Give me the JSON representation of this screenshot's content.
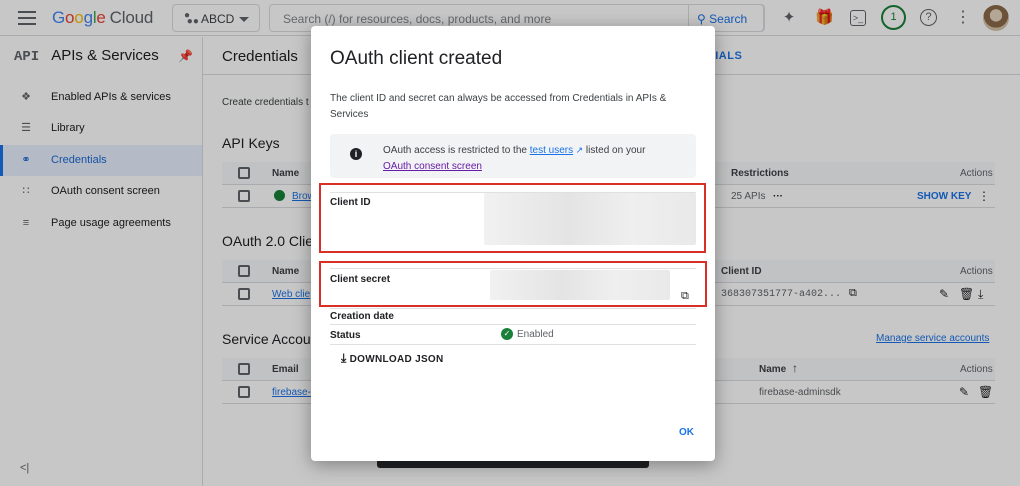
{
  "topbar": {
    "logo": {
      "g": "G",
      "o1": "o",
      "o2": "o",
      "g2": "g",
      "l": "l",
      "e": "e",
      "cloud": "Cloud"
    },
    "project": "ABCD",
    "search_placeholder": "Search (/) for resources, docs, products, and more",
    "search_button": "Search",
    "notifications_count": "1"
  },
  "sidebar": {
    "api_logo": "API",
    "title": "APIs & Services",
    "items": [
      {
        "label": "Enabled APIs & services",
        "icon": "diamond-icon"
      },
      {
        "label": "Library",
        "icon": "library-icon"
      },
      {
        "label": "Credentials",
        "icon": "key-icon"
      },
      {
        "label": "OAuth consent screen",
        "icon": "consent-icon"
      },
      {
        "label": "Page usage agreements",
        "icon": "agreements-icon"
      }
    ],
    "active": "Credentials"
  },
  "main": {
    "title": "Credentials",
    "tab_partial": "TIALS",
    "intro": "Create credentials t",
    "api_keys": {
      "title": "API Keys",
      "header": {
        "name": "Name",
        "restrictions": "Restrictions",
        "actions": "Actions"
      },
      "rows": [
        {
          "name": "Brow",
          "restrictions": "25 APIs",
          "more": "···",
          "show_key": "SHOW KEY"
        }
      ]
    },
    "oauth": {
      "title": "OAuth 2.0 Clie",
      "header": {
        "name": "Name",
        "client_id": "Client ID",
        "actions": "Actions"
      },
      "rows": [
        {
          "name": "Web clie",
          "client_id": "368307351777-a402..."
        }
      ]
    },
    "service": {
      "title": "Service Accou",
      "manage_link": "Manage service accounts",
      "header": {
        "email": "Email",
        "name": "Name",
        "actions": "Actions"
      },
      "rows": [
        {
          "email": "firebase-",
          "name": "firebase-adminsdk"
        }
      ]
    }
  },
  "dialog": {
    "title": "OAuth client created",
    "description": "The client ID and secret can always be accessed from Credentials in APIs & Services",
    "notice": {
      "prefix": "OAuth access is restricted to the ",
      "link1": "test users",
      "middle": " listed on your ",
      "link2": "OAuth consent screen"
    },
    "client_id_label": "Client ID",
    "client_secret_label": "Client secret",
    "creation_date_label": "Creation date",
    "status_label": "Status",
    "status_value": "Enabled",
    "download_label": "DOWNLOAD JSON",
    "ok_label": "OK"
  },
  "colors": {
    "accent": "#1a73e8",
    "highlight": "#d93025",
    "success": "#188038"
  }
}
